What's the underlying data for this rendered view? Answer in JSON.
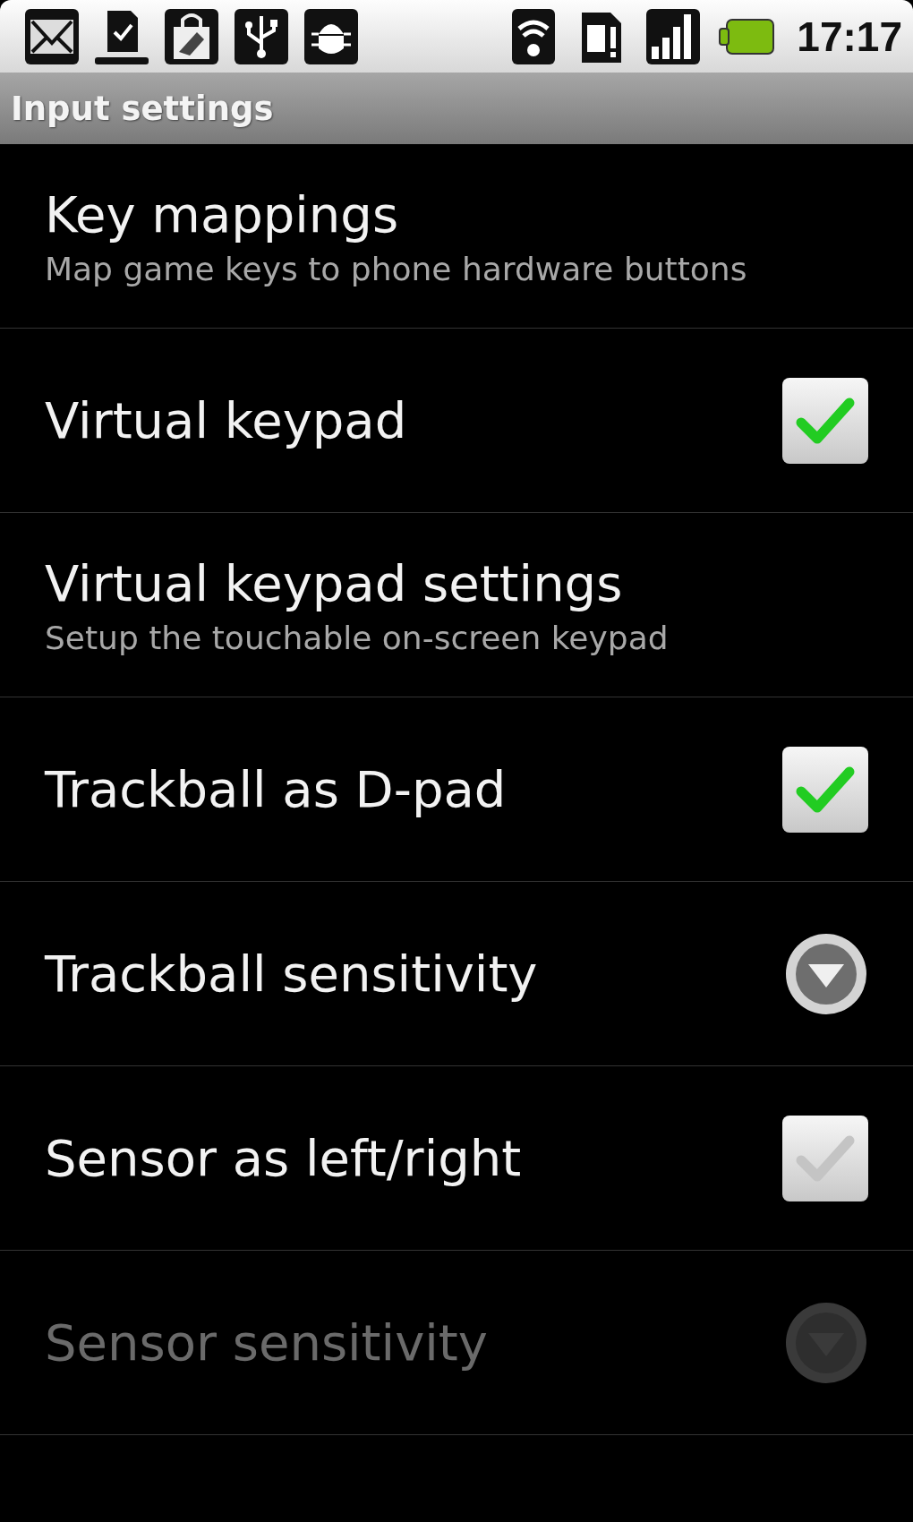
{
  "status_bar": {
    "time": "17:17"
  },
  "title_bar": {
    "title": "Input settings"
  },
  "preferences": [
    {
      "kind": "text",
      "title": "Key mappings",
      "summary": "Map game keys to phone hardware buttons",
      "disabled": false
    },
    {
      "kind": "checkbox",
      "title": "Virtual keypad",
      "checked": true,
      "disabled": false
    },
    {
      "kind": "text",
      "title": "Virtual keypad settings",
      "summary": "Setup the touchable on-screen keypad",
      "disabled": false
    },
    {
      "kind": "checkbox",
      "title": "Trackball as D-pad",
      "checked": true,
      "disabled": false
    },
    {
      "kind": "list",
      "title": "Trackball sensitivity",
      "disabled": false
    },
    {
      "kind": "checkbox",
      "title": "Sensor as left/right",
      "checked": false,
      "disabled": false
    },
    {
      "kind": "list",
      "title": "Sensor sensitivity",
      "disabled": true
    }
  ]
}
